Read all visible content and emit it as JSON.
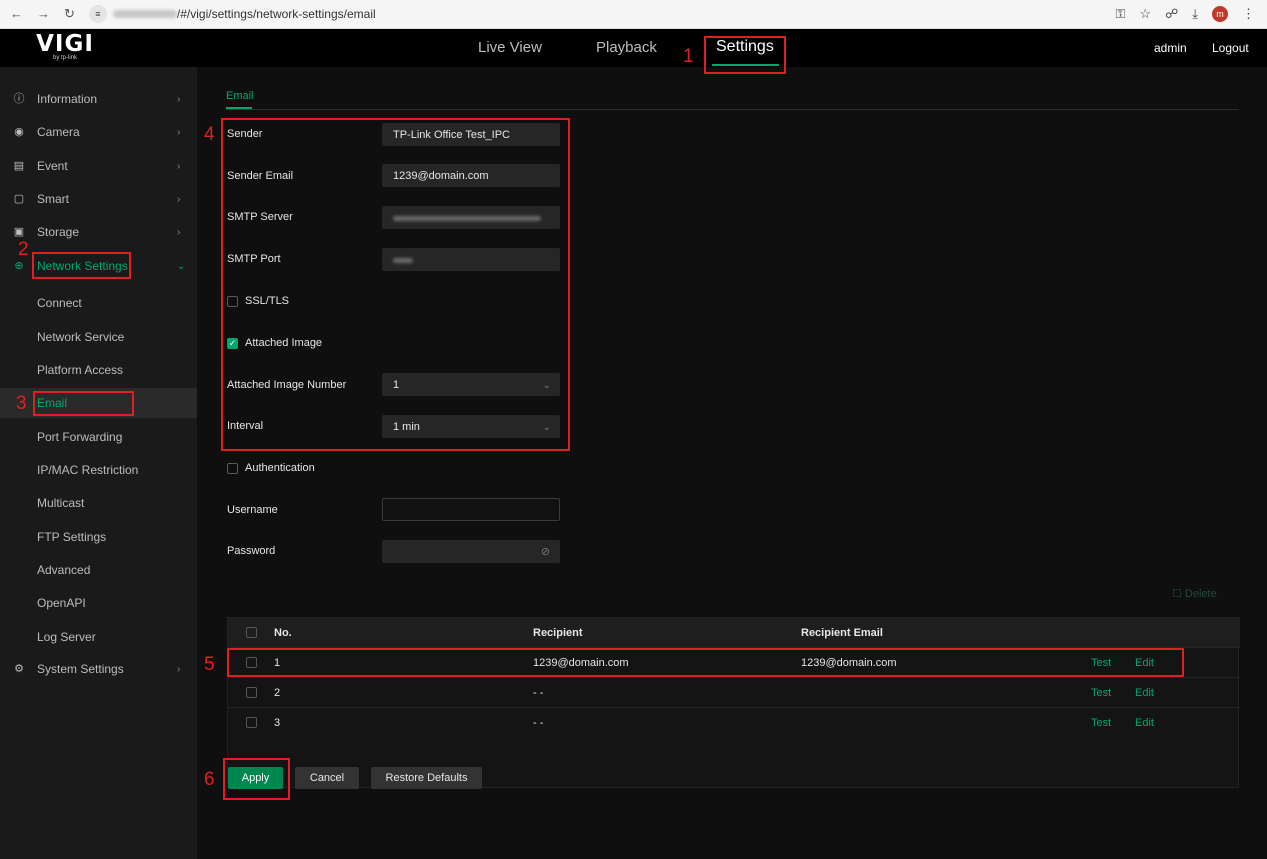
{
  "browser": {
    "url_path": "/#/vigi/settings/network-settings/email",
    "profile_initial": "m"
  },
  "header": {
    "logo": "VIGI",
    "logo_sub": "by tp-link",
    "tabs": [
      "Live View",
      "Playback",
      "Settings"
    ],
    "active_tab": "Settings",
    "user": "admin",
    "logout": "Logout"
  },
  "sidebar": {
    "items": [
      {
        "label": "Information",
        "icon": "info-icon"
      },
      {
        "label": "Camera",
        "icon": "camera-icon"
      },
      {
        "label": "Event",
        "icon": "event-icon"
      },
      {
        "label": "Smart",
        "icon": "smart-icon"
      },
      {
        "label": "Storage",
        "icon": "storage-icon"
      },
      {
        "label": "Network Settings",
        "icon": "globe-icon"
      },
      {
        "label": "System Settings",
        "icon": "system-icon"
      }
    ],
    "sub_items": [
      "Connect",
      "Network Service",
      "Platform Access",
      "Email",
      "Port Forwarding",
      "IP/MAC Restriction",
      "Multicast",
      "FTP Settings",
      "Advanced",
      "OpenAPI",
      "Log Server"
    ],
    "selected_sub": "Email"
  },
  "page": {
    "tab": "Email"
  },
  "form": {
    "sender_label": "Sender",
    "sender_value": "TP-Link Office Test_IPC",
    "sender_email_label": "Sender Email",
    "sender_email_value": "1239@domain.com",
    "smtp_server_label": "SMTP Server",
    "smtp_port_label": "SMTP Port",
    "ssl_label": "SSL/TLS",
    "ssl_checked": false,
    "attached_image_label": "Attached Image",
    "attached_image_checked": true,
    "attached_number_label": "Attached Image Number",
    "attached_number_value": "1",
    "interval_label": "Interval",
    "interval_value": "1 min",
    "auth_label": "Authentication",
    "auth_checked": false,
    "username_label": "Username",
    "username_value": "",
    "password_label": "Password",
    "password_value": ""
  },
  "table": {
    "delete_label": "Delete",
    "headers": [
      "No.",
      "Recipient",
      "Recipient Email"
    ],
    "rows": [
      {
        "no": "1",
        "recipient": "1239@domain.com",
        "email": "1239@domain.com",
        "test": "Test",
        "edit": "Edit"
      },
      {
        "no": "2",
        "recipient": "- -",
        "email": "",
        "test": "Test",
        "edit": "Edit"
      },
      {
        "no": "3",
        "recipient": "- -",
        "email": "",
        "test": "Test",
        "edit": "Edit"
      }
    ]
  },
  "buttons": {
    "apply": "Apply",
    "cancel": "Cancel",
    "restore": "Restore Defaults"
  },
  "annotations": [
    "1",
    "2",
    "3",
    "4",
    "5",
    "6"
  ],
  "colors": {
    "accent": "#00a870",
    "annotation": "#e02020",
    "background": "#0f0f0f",
    "sidebar": "#1a1a1a"
  }
}
